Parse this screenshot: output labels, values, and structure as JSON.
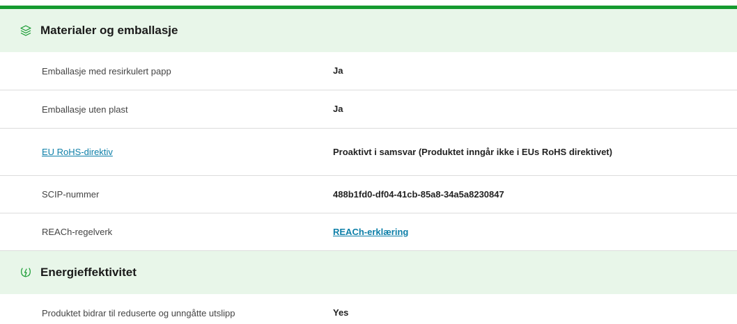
{
  "sections": [
    {
      "title": "Materialer og emballasje",
      "icon": "layers-icon",
      "rows": [
        {
          "label": "Emballasje med resirkulert papp",
          "value": "Ja"
        },
        {
          "label": "Emballasje uten plast",
          "value": "Ja"
        },
        {
          "label": "EU RoHS-direktiv",
          "value": "Proaktivt i samsvar (Produktet inngår ikke i EUs RoHS direktivet)"
        },
        {
          "label": "SCIP-nummer",
          "value": "488b1fd0-df04-41cb-85a8-34a5a8230847"
        },
        {
          "label": "REACh-regelverk",
          "value": "REACh-erklæring"
        }
      ]
    },
    {
      "title": "Energieffektivitet",
      "icon": "energy-leaf-icon",
      "rows": [
        {
          "label": "Produktet bidrar til reduserte og unngåtte utslipp",
          "value": "Yes"
        }
      ]
    }
  ],
  "colors": {
    "accent_bar": "#159a2f",
    "section_bg": "#e8f6e9",
    "link": "#0d7fa8"
  }
}
